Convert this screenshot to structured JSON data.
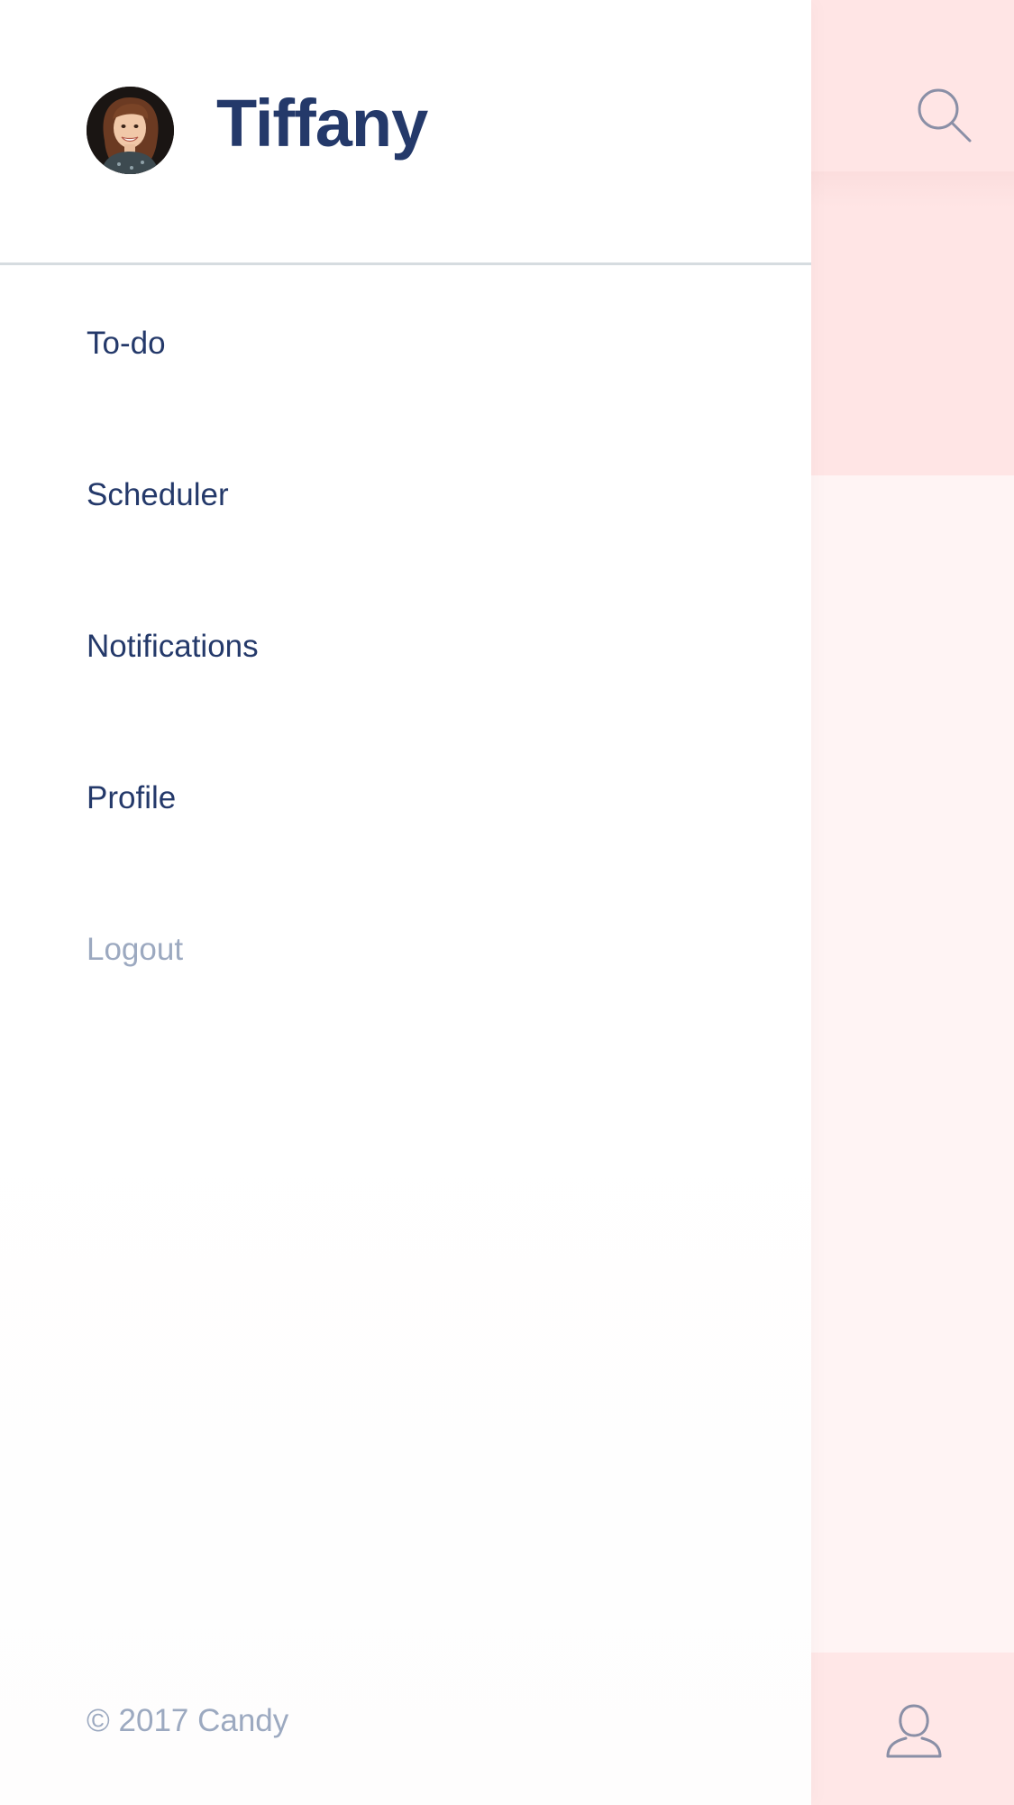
{
  "user": {
    "name": "Tiffany",
    "avatar_icon": "avatar-photo"
  },
  "menu": {
    "items": [
      {
        "label": "To-do",
        "state": "default"
      },
      {
        "label": "Scheduler",
        "state": "default"
      },
      {
        "label": "Notifications",
        "state": "default"
      },
      {
        "label": "Profile",
        "state": "default"
      },
      {
        "label": "Logout",
        "state": "muted"
      }
    ]
  },
  "footer": {
    "copyright": "© 2017 Candy"
  },
  "background_screen": {
    "top_icon": "search-icon",
    "bottom_icon": "user-icon"
  },
  "colors": {
    "primary_text": "#24396a",
    "muted_text": "#9ca9c0",
    "divider": "#d6dce0",
    "background_pink": "#ffe5e5",
    "background_pink_light": "#fff4f4"
  }
}
